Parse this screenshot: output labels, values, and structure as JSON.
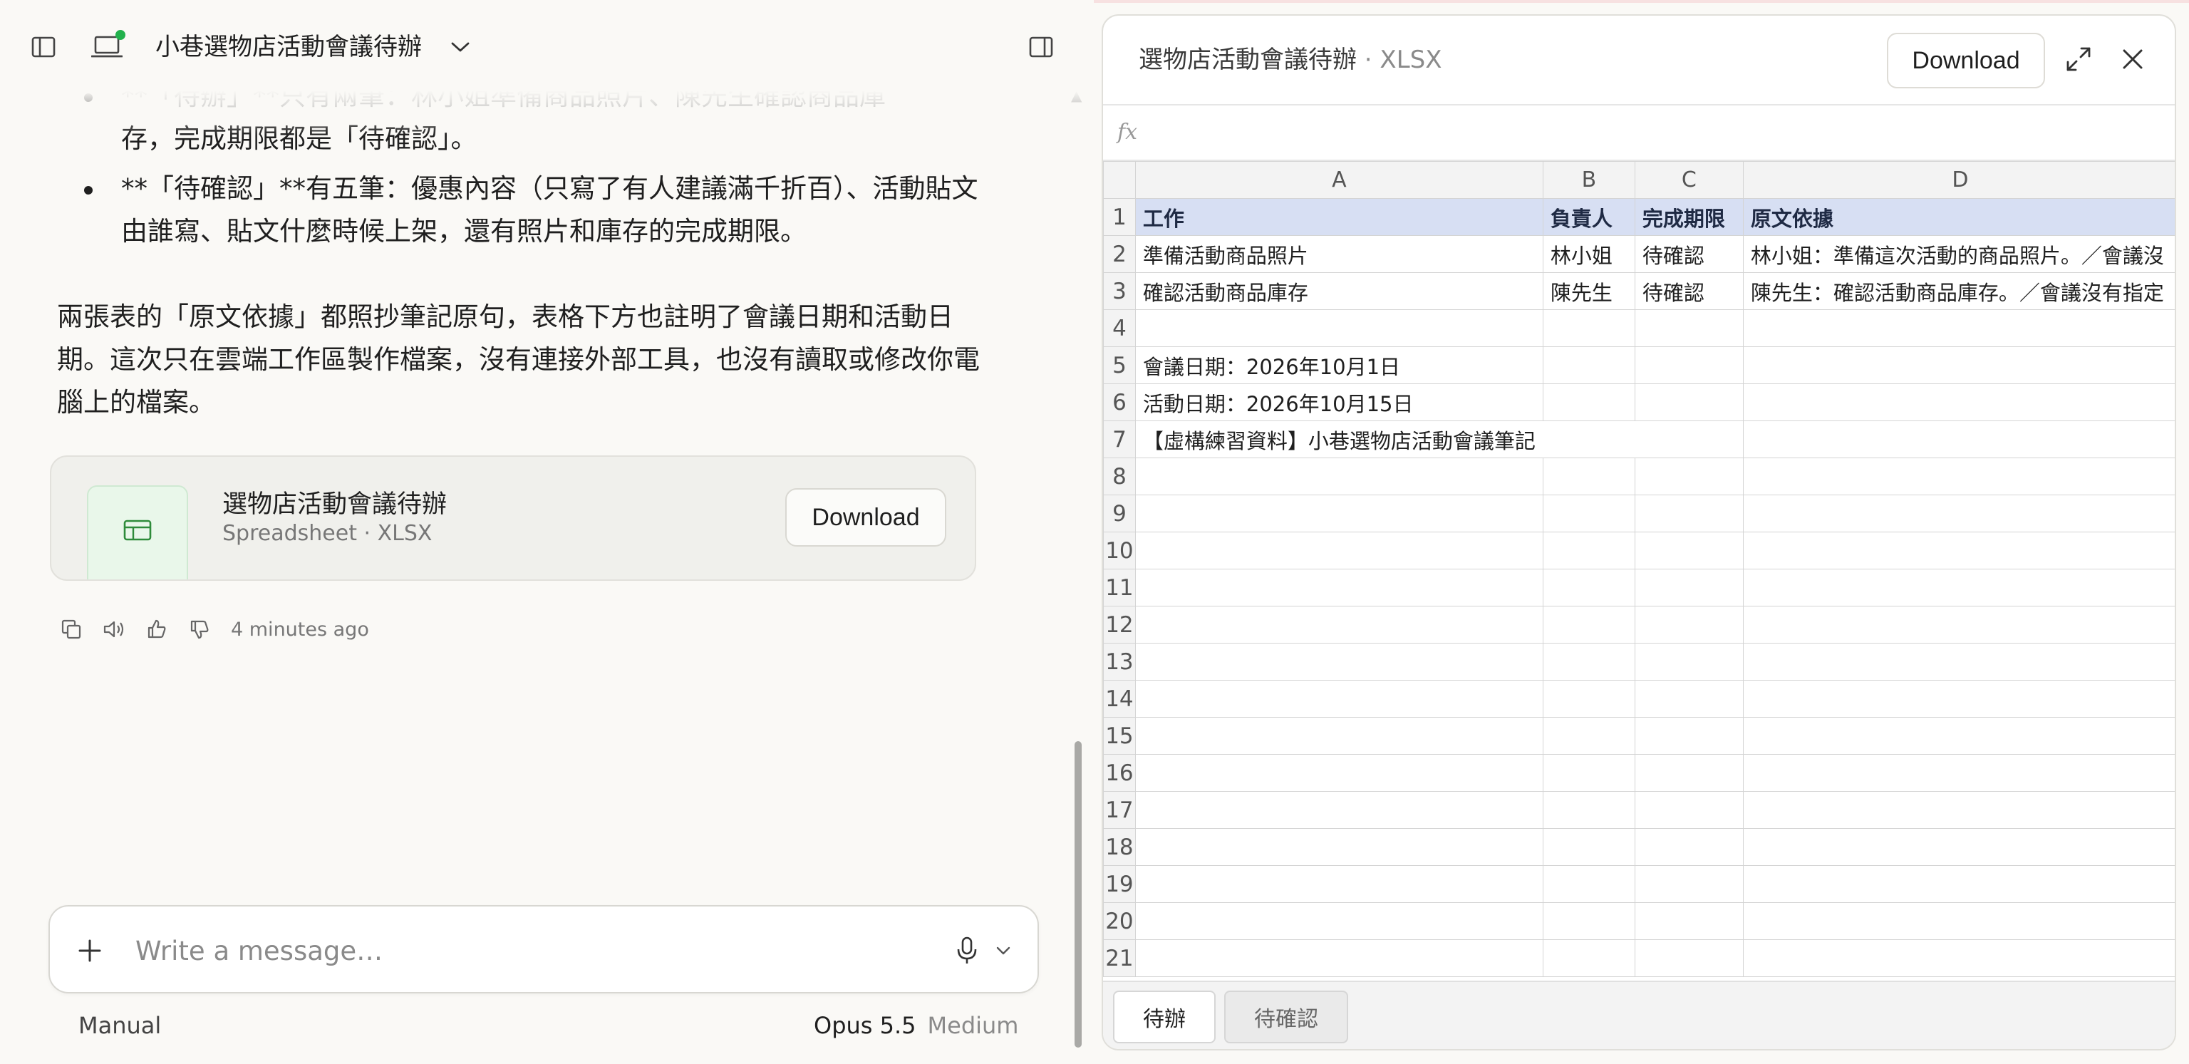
{
  "chat": {
    "title": "小巷選物店活動會議待辦",
    "bullets": [
      {
        "text_faded": "**「待辦」**只有兩筆：林小姐準備商品照片、陳先生確認商品庫",
        "text_rest": "存，完成期限都是「待確認」。"
      },
      {
        "text": "**「待確認」**有五筆：優惠內容（只寫了有人建議滿千折百）、活動貼文由誰寫、貼文什麼時候上架，還有照片和庫存的完成期限。"
      }
    ],
    "paragraph": "兩張表的「原文依據」都照抄筆記原句，表格下方也註明了會議日期和活動日期。這次只在雲端工作區製作檔案，沒有連接外部工具，也沒有讀取或修改你電腦上的檔案。",
    "file_card": {
      "name": "選物店活動會議待辦",
      "type": "Spreadsheet · XLSX",
      "download_label": "Download"
    },
    "timestamp": "4 minutes ago"
  },
  "composer": {
    "placeholder": "Write a message…",
    "mode": "Manual",
    "model": "Opus 5.5",
    "effort": "Medium"
  },
  "preview": {
    "title": "選物店活動會議待辦",
    "format": " · XLSX",
    "download_label": "Download",
    "formula_label": "fx",
    "columns": [
      "A",
      "B",
      "C",
      "D"
    ],
    "row_numbers": [
      "1",
      "2",
      "3",
      "4",
      "5",
      "6",
      "7",
      "8",
      "9",
      "10",
      "11",
      "12",
      "13",
      "14",
      "15",
      "16",
      "17",
      "18",
      "19",
      "20",
      "21"
    ],
    "header_row": [
      "工作",
      "負責人",
      "完成期限",
      "原文依據"
    ],
    "rows": [
      [
        "準備活動商品照片",
        "林小姐",
        "待確認",
        "林小姐：準備這次活動的商品照片。／會議沒"
      ],
      [
        "確認活動商品庫存",
        "陳先生",
        "待確認",
        "陳先生：確認活動商品庫存。／會議沒有指定"
      ]
    ],
    "notes": [
      "會議日期：2026年10月1日",
      "活動日期：2026年10月15日",
      "【虛構練習資料】小巷選物店活動會議筆記"
    ],
    "tabs": [
      "待辦",
      "待確認"
    ]
  },
  "colors": {
    "accent_green": "#22b14c",
    "header_fill": "#d7dff3",
    "sheet_icon": "#2e8b3a"
  }
}
